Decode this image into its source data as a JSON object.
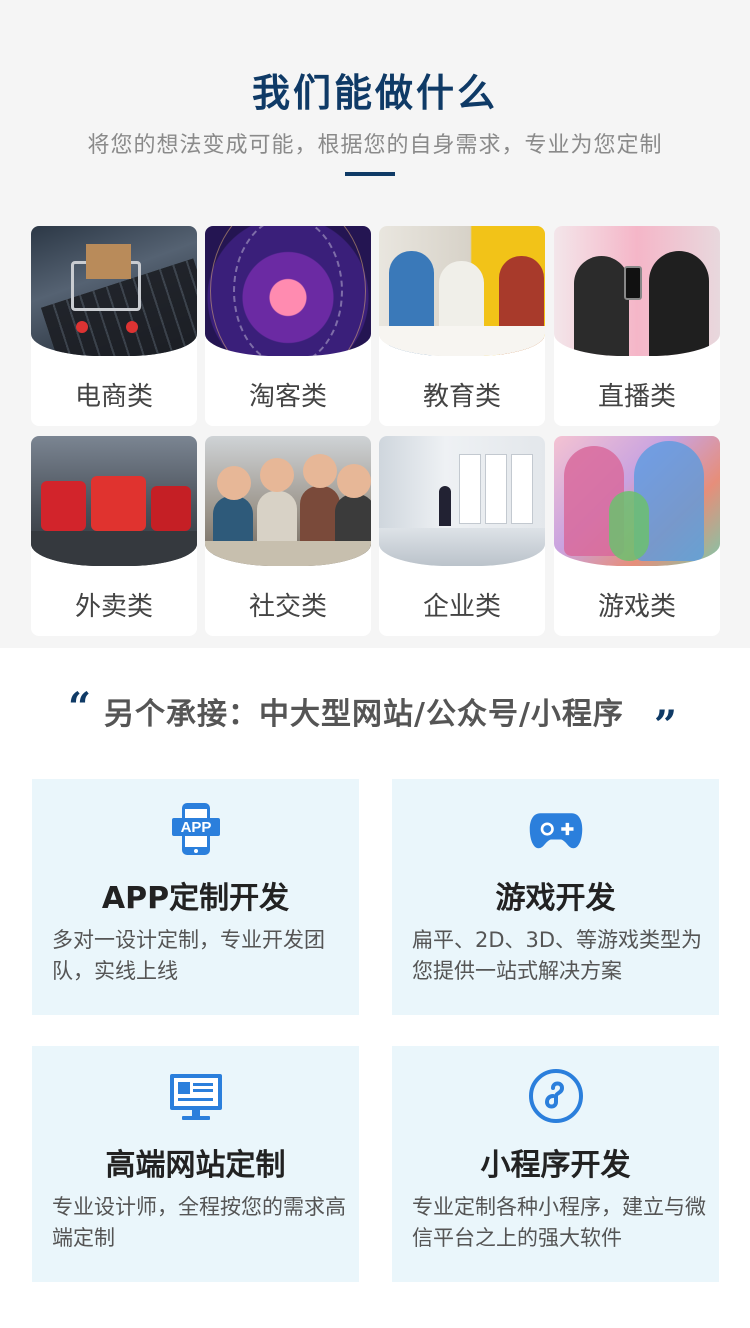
{
  "hero": {
    "title": "我们能做什么",
    "subtitle": "将您的想法变成可能，根据您的自身需求，专业为您定制"
  },
  "categories": [
    {
      "label": "电商类"
    },
    {
      "label": "淘客类"
    },
    {
      "label": "教育类"
    },
    {
      "label": "直播类"
    },
    {
      "label": "外卖类"
    },
    {
      "label": "社交类"
    },
    {
      "label": "企业类"
    },
    {
      "label": "游戏类"
    }
  ],
  "extra": {
    "open_quote": "“",
    "text": "另个承接：中大型网站/公众号/小程序",
    "close_quote": "”"
  },
  "services": [
    {
      "icon": "app-phone-icon",
      "title": "APP定制开发",
      "desc": "多对一设计定制，专业开发团队，实线上线"
    },
    {
      "icon": "gamepad-icon",
      "title": "游戏开发",
      "desc": "扁平、2D、3D、等游戏类型为您提供一站式解决方案"
    },
    {
      "icon": "website-monitor-icon",
      "title": "高端网站定制",
      "desc": "专业设计师，全程按您的需求高端定制"
    },
    {
      "icon": "mini-program-icon",
      "title": "小程序开发",
      "desc": "专业定制各种小程序，建立与微信平台之上的强大软件"
    }
  ],
  "colors": {
    "accent": "#0f3a66",
    "icon_blue": "#2b7fdc",
    "hero_bg": "#f5f5f5",
    "service_bg": "#eaf6fb"
  }
}
